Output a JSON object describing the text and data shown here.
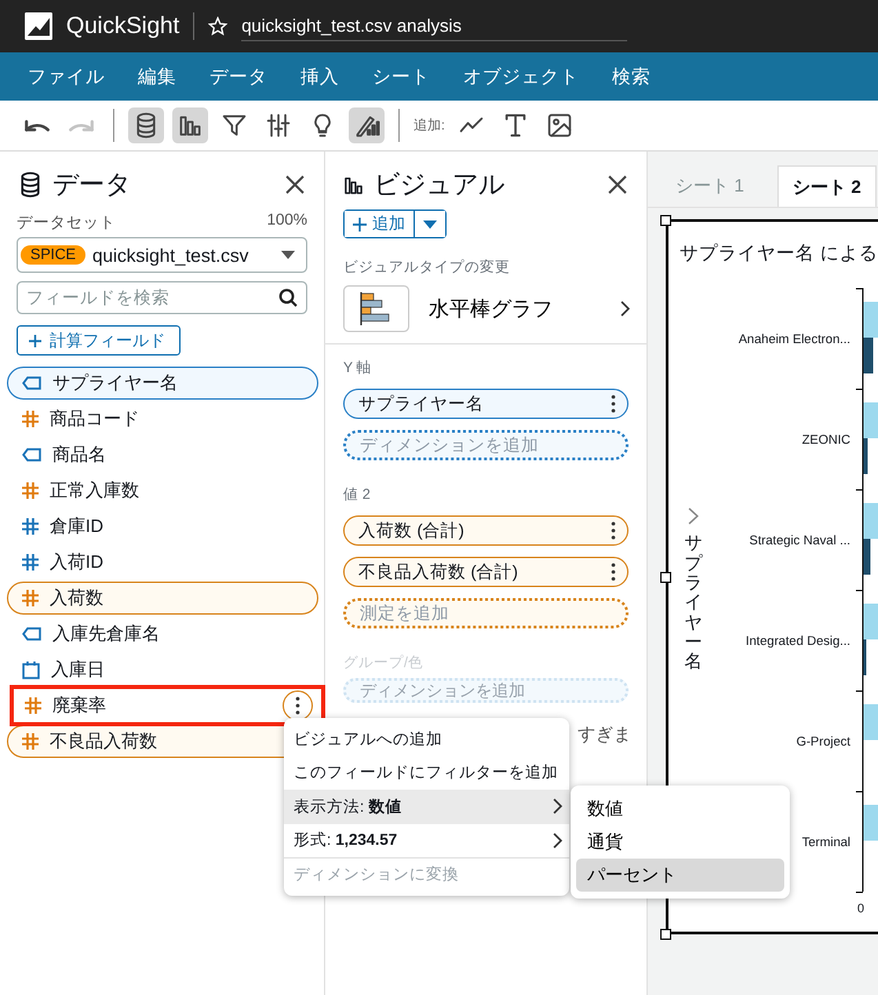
{
  "app_bar": {
    "product": "QuickSight",
    "title": "quicksight_test.csv analysis"
  },
  "menu": [
    "ファイル",
    "編集",
    "データ",
    "挿入",
    "シート",
    "オブジェクト",
    "検索"
  ],
  "toolbar": {
    "history": [
      {
        "kind": "undo",
        "disabled": false
      },
      {
        "kind": "redo",
        "disabled": true
      }
    ],
    "panels": [
      {
        "kind": "dataset",
        "active": true
      },
      {
        "kind": "visuals",
        "active": true
      },
      {
        "kind": "filter",
        "active": false
      },
      {
        "kind": "parameters",
        "active": false
      },
      {
        "kind": "insights",
        "active": false
      },
      {
        "kind": "themes",
        "active": true
      }
    ],
    "add_label": "追加:",
    "add": [
      {
        "kind": "line"
      },
      {
        "kind": "text"
      },
      {
        "kind": "image"
      }
    ]
  },
  "data_panel": {
    "title": "データ",
    "dataset_label": "データセット",
    "spice_usage": "100%",
    "dataset": {
      "badge": "SPICE",
      "name": "quicksight_test.csv"
    },
    "search": {
      "placeholder": "フィールドを検索"
    },
    "add_calculated_field": "計算フィールド",
    "fields": [
      {
        "name": "サプライヤー名",
        "kind": "dimension",
        "in_use": true,
        "highlighted": false
      },
      {
        "name": "商品コード",
        "kind": "measure",
        "in_use": false,
        "highlighted": false
      },
      {
        "name": "商品名",
        "kind": "dimension",
        "in_use": false,
        "highlighted": false
      },
      {
        "name": "正常入庫数",
        "kind": "measure",
        "in_use": false,
        "highlighted": false
      },
      {
        "name": "倉庫ID",
        "kind": "number_dimension",
        "in_use": false,
        "highlighted": false
      },
      {
        "name": "入荷ID",
        "kind": "number_dimension",
        "in_use": false,
        "highlighted": false
      },
      {
        "name": "入荷数",
        "kind": "measure",
        "in_use": true,
        "highlighted": false
      },
      {
        "name": "入庫先倉庫名",
        "kind": "dimension",
        "in_use": false,
        "highlighted": false
      },
      {
        "name": "入庫日",
        "kind": "date",
        "in_use": false,
        "highlighted": false
      },
      {
        "name": "廃棄率",
        "kind": "measure",
        "in_use": false,
        "highlighted": true
      },
      {
        "name": "不良品入荷数",
        "kind": "measure",
        "in_use": true,
        "highlighted": false
      }
    ]
  },
  "visual_panel": {
    "title": "ビジュアル",
    "add_button": "追加",
    "type_label": "ビジュアルタイプの変更",
    "visual_type": "水平棒グラフ",
    "wells": [
      {
        "label": "Y 軸",
        "kind": "dimension",
        "disabled": false,
        "fields": [
          "サプライヤー名"
        ],
        "placeholder": "ディメンションを追加"
      },
      {
        "label": "値 2",
        "kind": "measure",
        "disabled": false,
        "fields": [
          "入荷数 (合計)",
          "不良品入荷数 (合計)"
        ],
        "placeholder": "測定を追加"
      },
      {
        "label": "グループ/色",
        "kind": "dimension",
        "disabled": true,
        "placeholder": "ディメンションを追加"
      }
    ],
    "note_fragment": "すぎま"
  },
  "sheet": {
    "tabs": [
      {
        "label": "シート 1",
        "selected": false
      },
      {
        "label": "シート 2",
        "selected": true
      }
    ],
    "visual": {
      "title": "サプライヤー名 による",
      "axis_title": "サプライヤー名",
      "categories": [
        "Anaheim Electron...",
        "ZEONIC",
        "Strategic Naval ...",
        "Integrated Desig...",
        "G-Project",
        "Terminal"
      ],
      "x_tick": "0"
    }
  },
  "field_menu": {
    "items": [
      {
        "label": "ビジュアルへの追加",
        "submenu": false,
        "selected": false,
        "disabled": false
      },
      {
        "label": "このフィールドにフィルターを追加",
        "submenu": false,
        "selected": false,
        "disabled": false
      },
      {
        "label": "表示方法: **数値**",
        "submenu": true,
        "selected": true,
        "disabled": false
      },
      {
        "label": "形式: **1,234.57**",
        "submenu": true,
        "selected": false,
        "disabled": false
      },
      {
        "label": "ディメンションに変換",
        "submenu": false,
        "selected": false,
        "disabled": true
      }
    ],
    "submenu": [
      {
        "label": "数値",
        "selected": false
      },
      {
        "label": "通貨",
        "selected": false
      },
      {
        "label": "パーセント",
        "selected": true
      }
    ]
  }
}
